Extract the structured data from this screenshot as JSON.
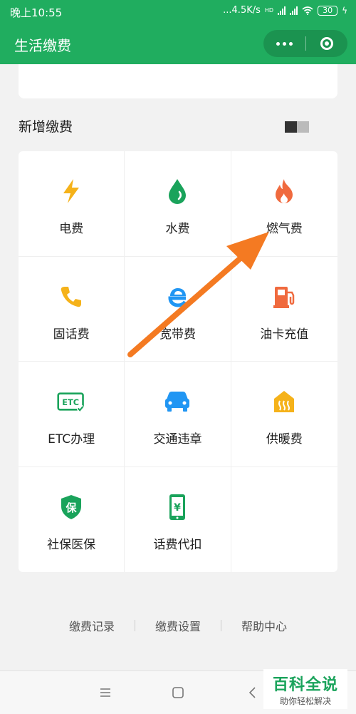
{
  "status_bar": {
    "time": "晚上10:55",
    "network_speed": "...4.5K/s",
    "network_type": "HD",
    "battery": "30"
  },
  "nav": {
    "title": "生活缴费",
    "more_icon": "more-dots-icon",
    "close_icon": "target-circle-icon"
  },
  "section": {
    "title": "新增缴费"
  },
  "services": [
    {
      "label": "电费",
      "icon": "lightning-icon",
      "color": "#f5b21a"
    },
    {
      "label": "水费",
      "icon": "water-drop-icon",
      "color": "#1aa35b"
    },
    {
      "label": "燃气费",
      "icon": "flame-icon",
      "color": "#f06a3e"
    },
    {
      "label": "固话费",
      "icon": "phone-icon",
      "color": "#f5b21a"
    },
    {
      "label": "宽带费",
      "icon": "browser-e-icon",
      "color": "#2196f3"
    },
    {
      "label": "油卡充值",
      "icon": "fuel-pump-icon",
      "color": "#f06a3e"
    },
    {
      "label": "ETC办理",
      "icon": "etc-card-icon",
      "color": "#1aa35b"
    },
    {
      "label": "交通违章",
      "icon": "car-icon",
      "color": "#2196f3"
    },
    {
      "label": "供暖费",
      "icon": "heating-house-icon",
      "color": "#f5b21a"
    },
    {
      "label": "社保医保",
      "icon": "shield-bao-icon",
      "color": "#1aa35b"
    },
    {
      "label": "话费代扣",
      "icon": "mobile-yuan-icon",
      "color": "#1aa35b"
    }
  ],
  "footer": {
    "links": [
      "缴费记录",
      "缴费设置",
      "帮助中心"
    ]
  },
  "watermark": {
    "main": "百科全说",
    "sub": "助你轻松解决"
  },
  "colors": {
    "brand_green": "#20ad5f",
    "arrow_orange": "#f47a22"
  }
}
